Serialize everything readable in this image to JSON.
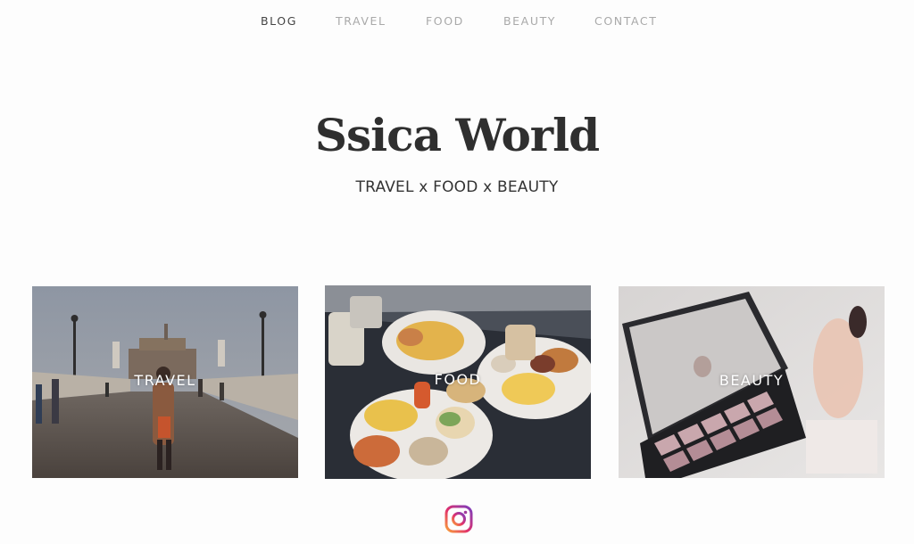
{
  "nav": {
    "items": [
      {
        "label": "BLOG",
        "active": true
      },
      {
        "label": "TRAVEL",
        "active": false
      },
      {
        "label": "FOOD",
        "active": false
      },
      {
        "label": "BEAUTY",
        "active": false
      },
      {
        "label": "CONTACT",
        "active": false
      }
    ]
  },
  "header": {
    "title": "Ssica World",
    "tagline": "TRAVEL x FOOD x BEAUTY"
  },
  "categories": [
    {
      "label": "TRAVEL",
      "image": "rome-bridge-photo"
    },
    {
      "label": "FOOD",
      "image": "brunch-plates-photo"
    },
    {
      "label": "BEAUTY",
      "image": "eyeshadow-palette-photo"
    }
  ],
  "footer": {
    "social_icon": "instagram-icon"
  },
  "colors": {
    "background": "#fdfdfd",
    "nav_active": "#444444",
    "nav_inactive": "#a9a9a9",
    "title": "#2f2f2f"
  }
}
